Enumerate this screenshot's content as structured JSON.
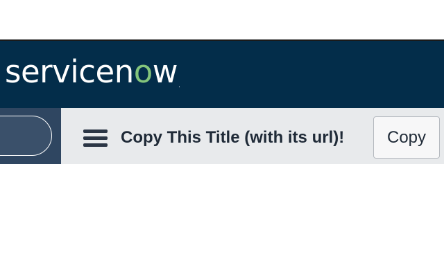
{
  "header": {
    "logo_prefix": "servicen",
    "logo_o": "o",
    "logo_suffix": "w",
    "logo_tm": "."
  },
  "toolbar": {
    "title": "Copy This Title (with its url)!",
    "copy_label": "Copy",
    "menu_icon": "hamburger-menu-icon"
  },
  "colors": {
    "header_bg": "#032d4a",
    "logo_accent": "#84c57b",
    "toolbar_bg": "#e8eaec",
    "left_panel_bg": "#2f4661"
  }
}
